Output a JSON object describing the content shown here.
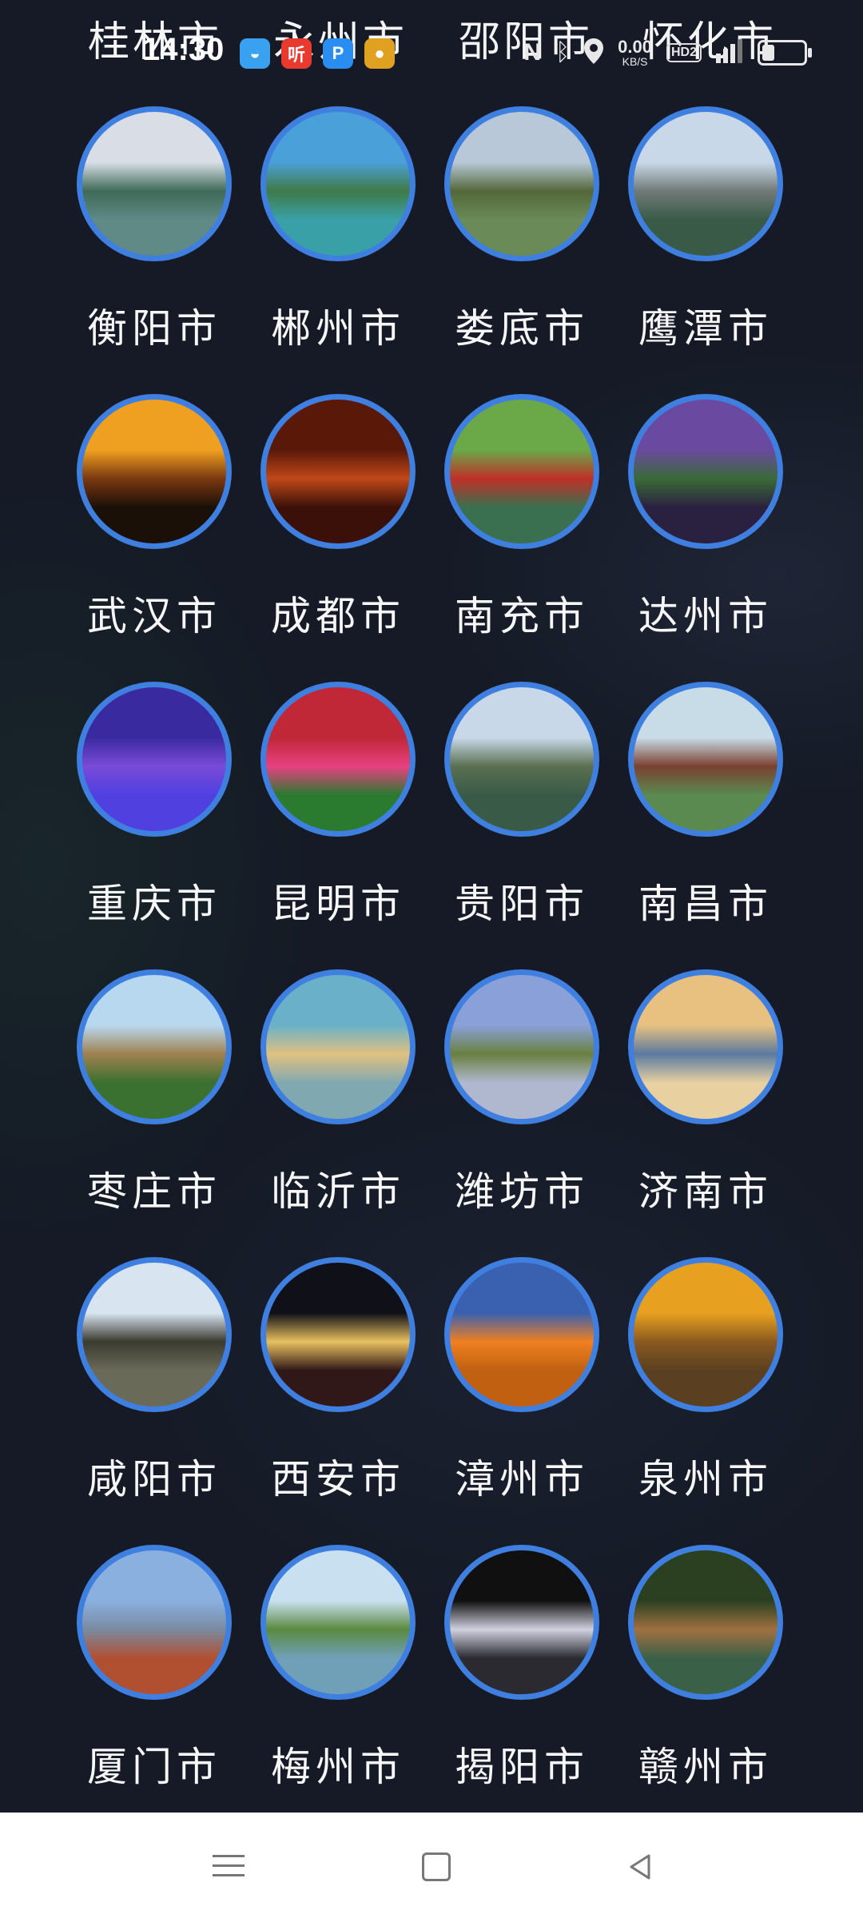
{
  "status_bar": {
    "time": "14:30",
    "net_speed_value": "0.00",
    "net_speed_unit": "KB/S",
    "hd_label": "HD2",
    "battery_level": 0.3,
    "notification_icons": [
      {
        "name": "cloud-app-icon",
        "glyph": "◒",
        "color": "#3aa0f0"
      },
      {
        "name": "ting-app-icon",
        "glyph": "听",
        "color": "#e83a2e"
      },
      {
        "name": "p-app-icon",
        "glyph": "P",
        "color": "#2a8df0"
      },
      {
        "name": "multicolor-app-icon",
        "glyph": "●",
        "color": "#e0a020"
      }
    ]
  },
  "top_partial_row": [
    "桂林市",
    "永州市",
    "邵阳市",
    "怀化市"
  ],
  "cities": [
    {
      "name": "衡阳市"
    },
    {
      "name": "郴州市"
    },
    {
      "name": "娄底市"
    },
    {
      "name": "鹰潭市"
    },
    {
      "name": "武汉市"
    },
    {
      "name": "成都市"
    },
    {
      "name": "南充市"
    },
    {
      "name": "达州市"
    },
    {
      "name": "重庆市"
    },
    {
      "name": "昆明市"
    },
    {
      "name": "贵阳市"
    },
    {
      "name": "南昌市"
    },
    {
      "name": "枣庄市"
    },
    {
      "name": "临沂市"
    },
    {
      "name": "潍坊市"
    },
    {
      "name": "济南市"
    },
    {
      "name": "咸阳市"
    },
    {
      "name": "西安市"
    },
    {
      "name": "漳州市"
    },
    {
      "name": "泉州市"
    },
    {
      "name": "厦门市"
    },
    {
      "name": "梅州市"
    },
    {
      "name": "揭阳市"
    },
    {
      "name": "赣州市"
    }
  ],
  "colors": {
    "background": "#151a26",
    "thumb_border": "#3f7fe0",
    "label": "#f7f7f7",
    "nav_bar": "#ffffff"
  }
}
